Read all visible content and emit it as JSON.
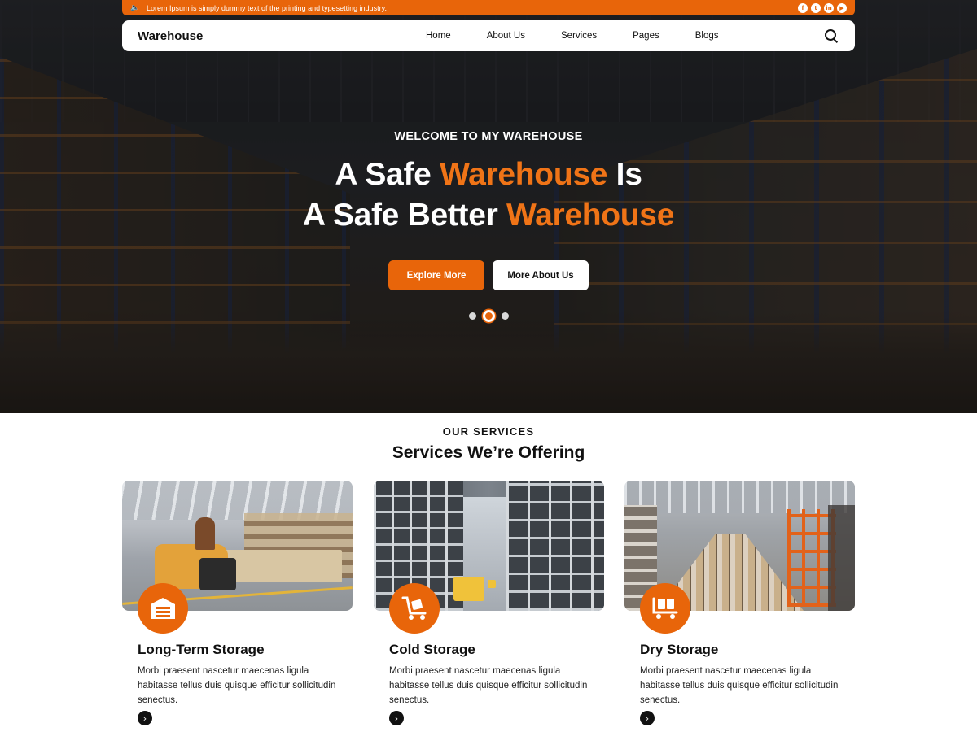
{
  "colors": {
    "accent": "#e8650a",
    "accent_text": "#f07417",
    "dark": "#111111",
    "white": "#ffffff"
  },
  "topbar": {
    "ticker_text": "Lorem Ipsum is simply dummy text of the printing and typesetting industry.",
    "speaker_icon": "speaker-icon",
    "socials": [
      {
        "name": "facebook-icon",
        "glyph": "f"
      },
      {
        "name": "twitter-icon",
        "glyph": "t"
      },
      {
        "name": "linkedin-icon",
        "glyph": "in"
      },
      {
        "name": "youtube-icon",
        "glyph": "▶"
      }
    ]
  },
  "nav": {
    "brand": "Warehouse",
    "items": [
      {
        "label": "Home"
      },
      {
        "label": "About Us"
      },
      {
        "label": "Services"
      },
      {
        "label": "Pages"
      },
      {
        "label": "Blogs"
      }
    ],
    "search_icon": "search-icon"
  },
  "hero": {
    "eyebrow": "WELCOME TO MY WAREHOUSE",
    "line1_prefix": "A Safe ",
    "line1_accent": "Warehouse",
    "line1_suffix": " Is",
    "line2_prefix": "A Safe Better ",
    "line2_accent": "Warehouse",
    "primary_button": "Explore More",
    "secondary_button": "More About Us",
    "slider": {
      "count": 3,
      "active_index": 1
    }
  },
  "services": {
    "eyebrow": "OUR SERVICES",
    "title": "Services We’re Offering",
    "cards": [
      {
        "title": "Long-Term Storage",
        "description": "Morbi praesent nascetur maecenas ligula habitasse tellus duis quisque efficitur sollicitudin senectus.",
        "icon": "warehouse-garage-icon"
      },
      {
        "title": "Cold Storage",
        "description": "Morbi praesent nascetur maecenas ligula habitasse tellus duis quisque efficitur sollicitudin senectus.",
        "icon": "hand-truck-icon"
      },
      {
        "title": "Dry Storage",
        "description": "Morbi praesent nascetur maecenas ligula habitasse tellus duis quisque efficitur sollicitudin senectus.",
        "icon": "dolly-boxes-icon"
      }
    ],
    "arrow_glyph": "›"
  }
}
